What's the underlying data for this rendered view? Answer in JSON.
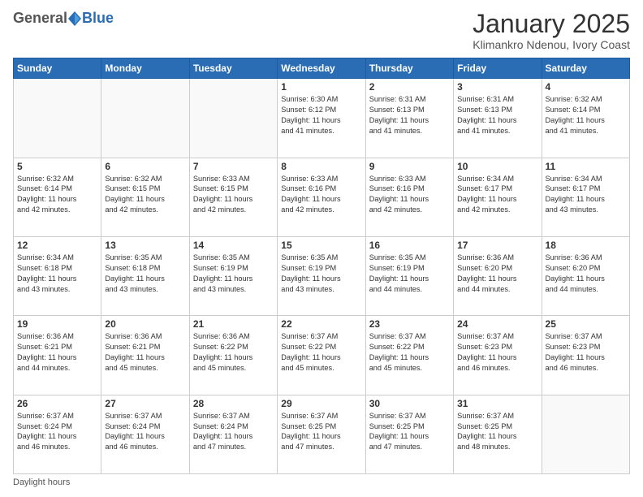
{
  "header": {
    "logo_general": "General",
    "logo_blue": "Blue",
    "month_title": "January 2025",
    "location": "Klimankro Ndenou, Ivory Coast"
  },
  "days_of_week": [
    "Sunday",
    "Monday",
    "Tuesday",
    "Wednesday",
    "Thursday",
    "Friday",
    "Saturday"
  ],
  "footer": {
    "daylight_label": "Daylight hours"
  },
  "weeks": [
    [
      {
        "day": "",
        "info": ""
      },
      {
        "day": "",
        "info": ""
      },
      {
        "day": "",
        "info": ""
      },
      {
        "day": "1",
        "info": "Sunrise: 6:30 AM\nSunset: 6:12 PM\nDaylight: 11 hours\nand 41 minutes."
      },
      {
        "day": "2",
        "info": "Sunrise: 6:31 AM\nSunset: 6:13 PM\nDaylight: 11 hours\nand 41 minutes."
      },
      {
        "day": "3",
        "info": "Sunrise: 6:31 AM\nSunset: 6:13 PM\nDaylight: 11 hours\nand 41 minutes."
      },
      {
        "day": "4",
        "info": "Sunrise: 6:32 AM\nSunset: 6:14 PM\nDaylight: 11 hours\nand 41 minutes."
      }
    ],
    [
      {
        "day": "5",
        "info": "Sunrise: 6:32 AM\nSunset: 6:14 PM\nDaylight: 11 hours\nand 42 minutes."
      },
      {
        "day": "6",
        "info": "Sunrise: 6:32 AM\nSunset: 6:15 PM\nDaylight: 11 hours\nand 42 minutes."
      },
      {
        "day": "7",
        "info": "Sunrise: 6:33 AM\nSunset: 6:15 PM\nDaylight: 11 hours\nand 42 minutes."
      },
      {
        "day": "8",
        "info": "Sunrise: 6:33 AM\nSunset: 6:16 PM\nDaylight: 11 hours\nand 42 minutes."
      },
      {
        "day": "9",
        "info": "Sunrise: 6:33 AM\nSunset: 6:16 PM\nDaylight: 11 hours\nand 42 minutes."
      },
      {
        "day": "10",
        "info": "Sunrise: 6:34 AM\nSunset: 6:17 PM\nDaylight: 11 hours\nand 42 minutes."
      },
      {
        "day": "11",
        "info": "Sunrise: 6:34 AM\nSunset: 6:17 PM\nDaylight: 11 hours\nand 43 minutes."
      }
    ],
    [
      {
        "day": "12",
        "info": "Sunrise: 6:34 AM\nSunset: 6:18 PM\nDaylight: 11 hours\nand 43 minutes."
      },
      {
        "day": "13",
        "info": "Sunrise: 6:35 AM\nSunset: 6:18 PM\nDaylight: 11 hours\nand 43 minutes."
      },
      {
        "day": "14",
        "info": "Sunrise: 6:35 AM\nSunset: 6:19 PM\nDaylight: 11 hours\nand 43 minutes."
      },
      {
        "day": "15",
        "info": "Sunrise: 6:35 AM\nSunset: 6:19 PM\nDaylight: 11 hours\nand 43 minutes."
      },
      {
        "day": "16",
        "info": "Sunrise: 6:35 AM\nSunset: 6:19 PM\nDaylight: 11 hours\nand 44 minutes."
      },
      {
        "day": "17",
        "info": "Sunrise: 6:36 AM\nSunset: 6:20 PM\nDaylight: 11 hours\nand 44 minutes."
      },
      {
        "day": "18",
        "info": "Sunrise: 6:36 AM\nSunset: 6:20 PM\nDaylight: 11 hours\nand 44 minutes."
      }
    ],
    [
      {
        "day": "19",
        "info": "Sunrise: 6:36 AM\nSunset: 6:21 PM\nDaylight: 11 hours\nand 44 minutes."
      },
      {
        "day": "20",
        "info": "Sunrise: 6:36 AM\nSunset: 6:21 PM\nDaylight: 11 hours\nand 45 minutes."
      },
      {
        "day": "21",
        "info": "Sunrise: 6:36 AM\nSunset: 6:22 PM\nDaylight: 11 hours\nand 45 minutes."
      },
      {
        "day": "22",
        "info": "Sunrise: 6:37 AM\nSunset: 6:22 PM\nDaylight: 11 hours\nand 45 minutes."
      },
      {
        "day": "23",
        "info": "Sunrise: 6:37 AM\nSunset: 6:22 PM\nDaylight: 11 hours\nand 45 minutes."
      },
      {
        "day": "24",
        "info": "Sunrise: 6:37 AM\nSunset: 6:23 PM\nDaylight: 11 hours\nand 46 minutes."
      },
      {
        "day": "25",
        "info": "Sunrise: 6:37 AM\nSunset: 6:23 PM\nDaylight: 11 hours\nand 46 minutes."
      }
    ],
    [
      {
        "day": "26",
        "info": "Sunrise: 6:37 AM\nSunset: 6:24 PM\nDaylight: 11 hours\nand 46 minutes."
      },
      {
        "day": "27",
        "info": "Sunrise: 6:37 AM\nSunset: 6:24 PM\nDaylight: 11 hours\nand 46 minutes."
      },
      {
        "day": "28",
        "info": "Sunrise: 6:37 AM\nSunset: 6:24 PM\nDaylight: 11 hours\nand 47 minutes."
      },
      {
        "day": "29",
        "info": "Sunrise: 6:37 AM\nSunset: 6:25 PM\nDaylight: 11 hours\nand 47 minutes."
      },
      {
        "day": "30",
        "info": "Sunrise: 6:37 AM\nSunset: 6:25 PM\nDaylight: 11 hours\nand 47 minutes."
      },
      {
        "day": "31",
        "info": "Sunrise: 6:37 AM\nSunset: 6:25 PM\nDaylight: 11 hours\nand 48 minutes."
      },
      {
        "day": "",
        "info": ""
      }
    ]
  ]
}
